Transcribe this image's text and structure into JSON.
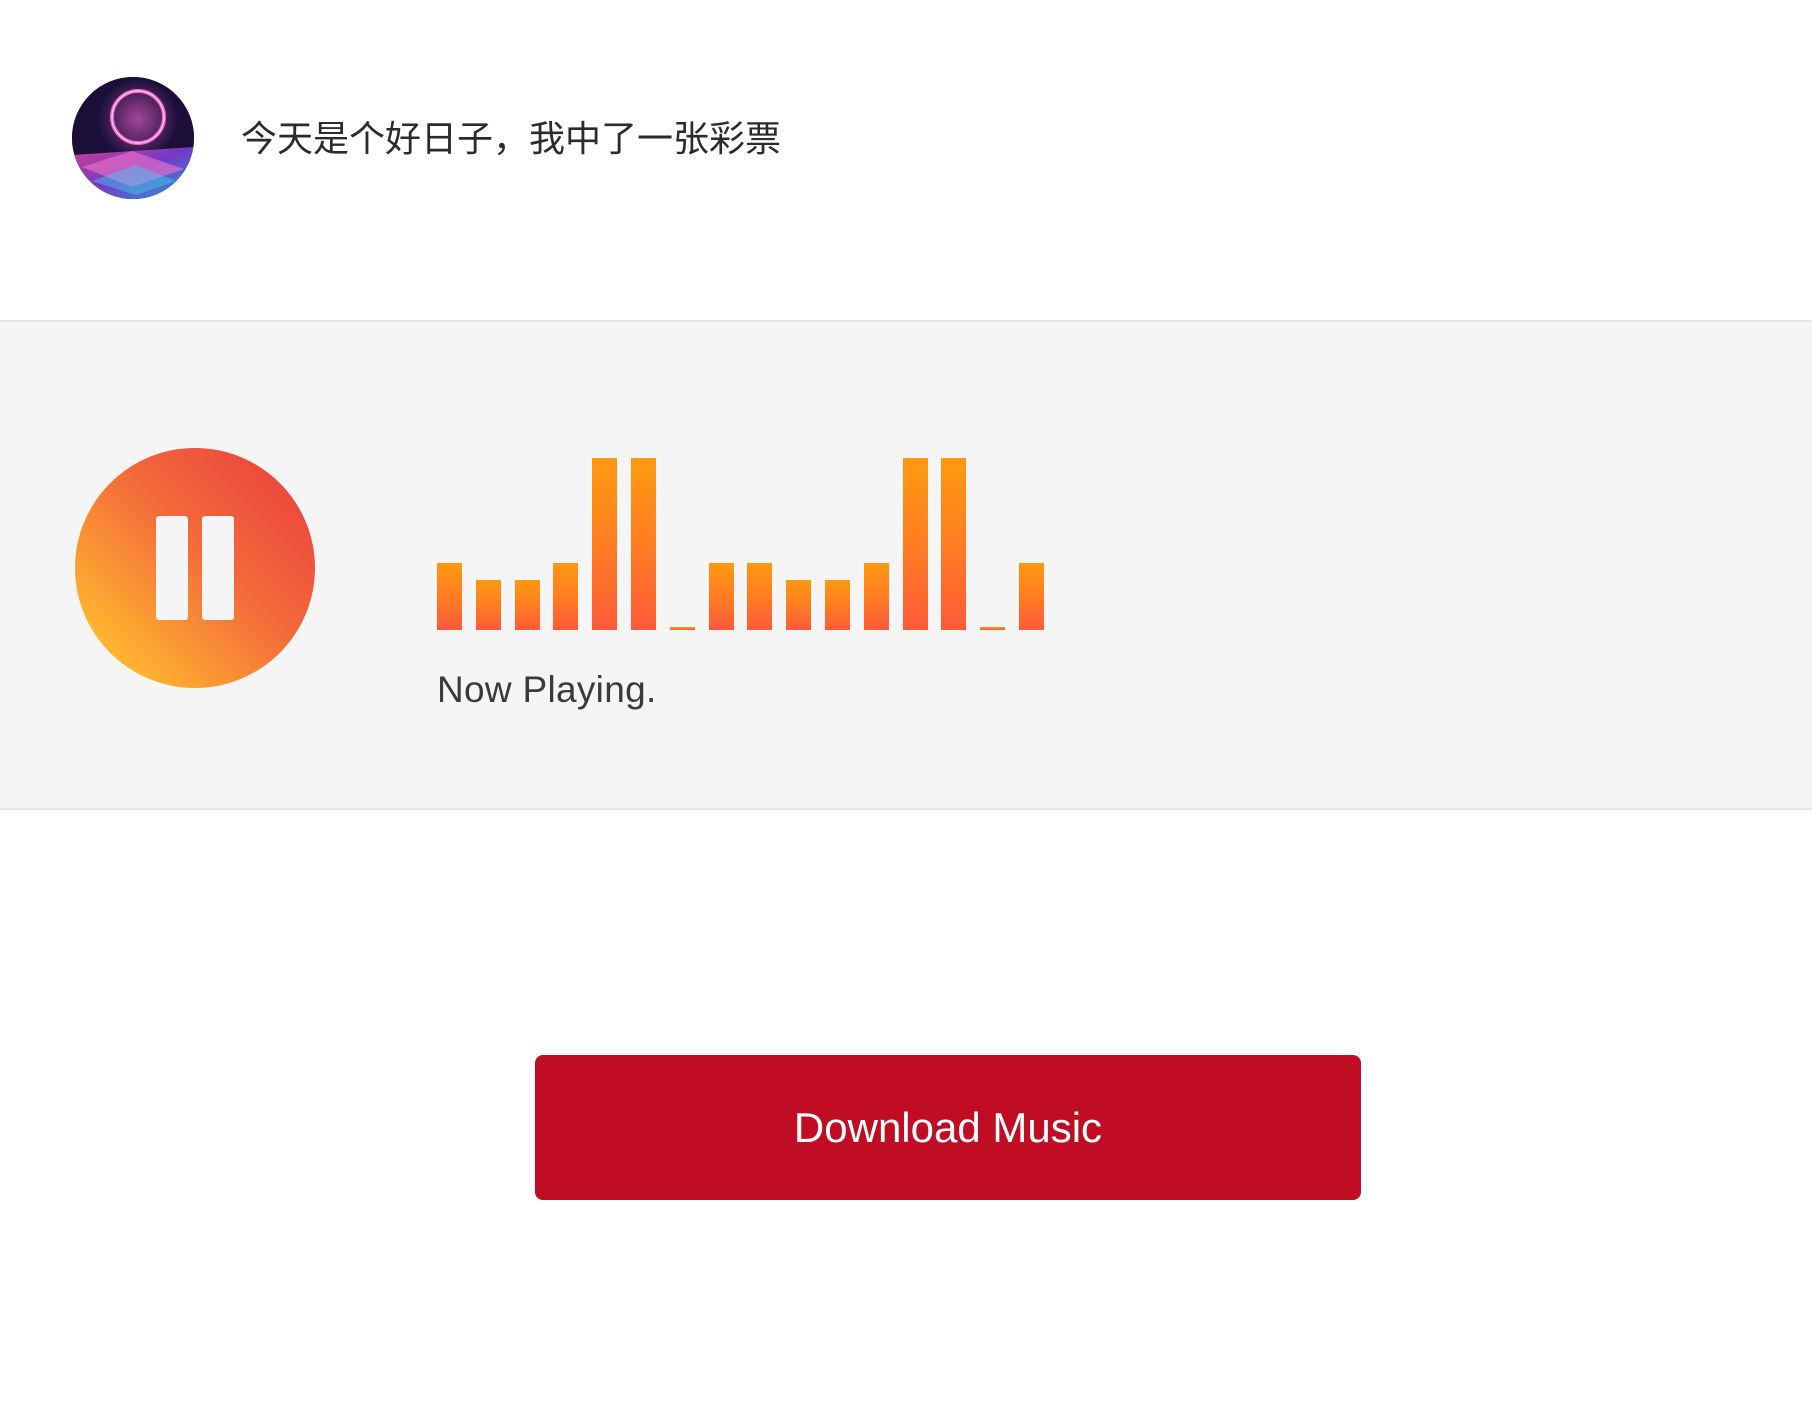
{
  "post": {
    "avatar_alt": "avatar",
    "message": "今天是个好日子，我中了一张彩票"
  },
  "player": {
    "status_label": "Now Playing.",
    "state": "playing",
    "control_icon": "pause-icon",
    "accent_gradient": [
      "#ea3a3f",
      "#ffc52c"
    ],
    "equalizer_levels": [
      0.39,
      0.29,
      0.29,
      0.39,
      1.0,
      1.0,
      0.02,
      0.39,
      0.39,
      0.29,
      0.29,
      0.39,
      1.0,
      1.0,
      0.02,
      0.39
    ],
    "equalizer_colors": [
      "#ff9a10",
      "#ff5a3a"
    ]
  },
  "download": {
    "label": "Download Music",
    "color": "#c10d23"
  }
}
